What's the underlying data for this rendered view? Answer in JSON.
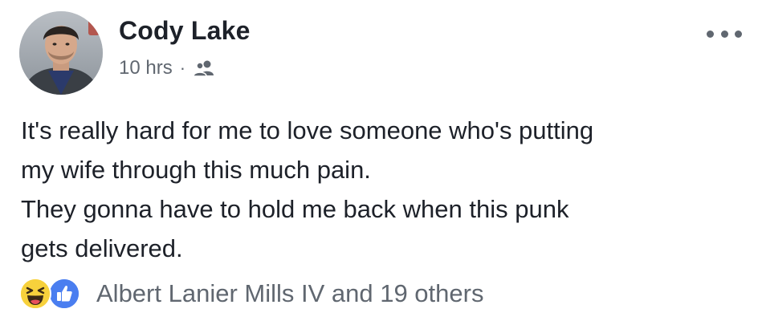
{
  "post": {
    "author": {
      "name": "Cody Lake",
      "avatar_icon": "profile-photo"
    },
    "meta": {
      "time": "10 hrs",
      "separator": "·",
      "audience_icon": "friends-icon"
    },
    "more_icon": "more-options-icon",
    "body": {
      "line1": "It's really hard for me to love someone who's putting\nmy wife through this much pain.",
      "line2": "They gonna have to hold me back when this punk\ngets delivered."
    },
    "reactions": {
      "icons": [
        "haha-icon",
        "like-icon"
      ],
      "summary": "Albert Lanier Mills IV and 19 others"
    }
  },
  "colors": {
    "text_primary": "#1d2129",
    "text_secondary": "#606770",
    "like_blue": "#4a7ef0",
    "haha_yellow": "#f7d13c"
  }
}
